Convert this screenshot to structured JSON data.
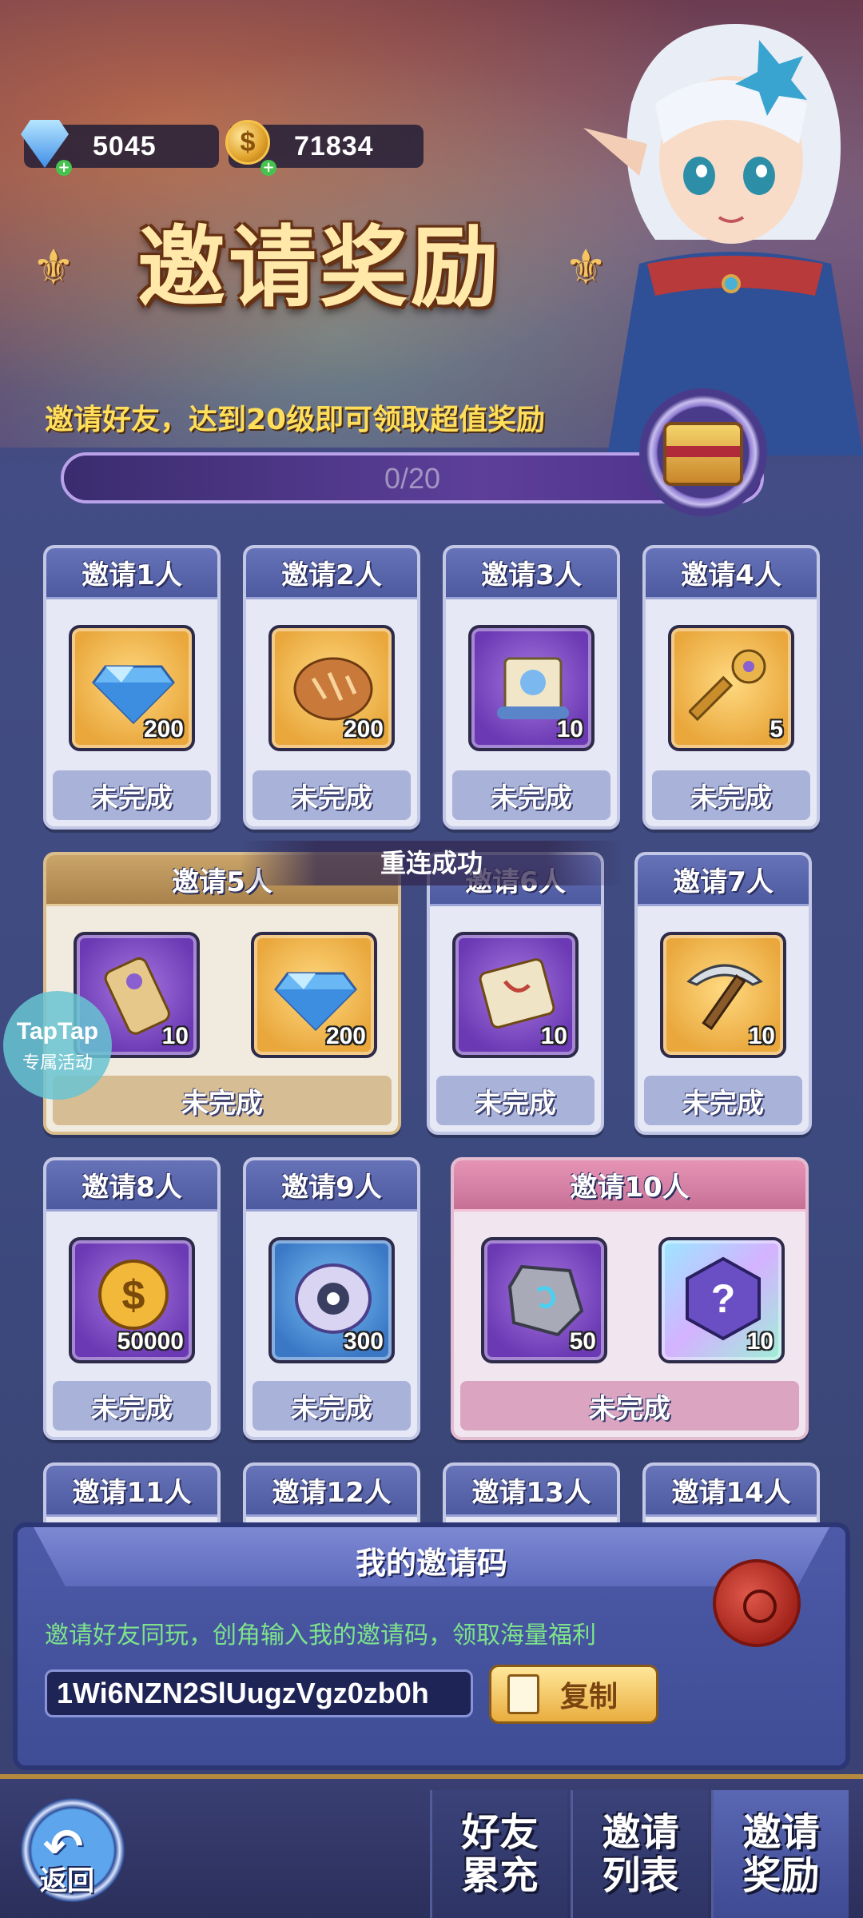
{
  "currency": {
    "gems": "5045",
    "coins": "71834"
  },
  "banner": {
    "title": "邀请奖励",
    "subtitle": "邀请好友，达到20级即可领取超值奖励",
    "progress_text": "0/20",
    "progress": 0
  },
  "toast": "重连成功",
  "taptap": {
    "brand": "TapTap",
    "label": "专属活动"
  },
  "cards": [
    {
      "title": "邀请1人",
      "status": "未完成",
      "items": [
        {
          "icon": "diamond-icon",
          "qty": "200"
        }
      ]
    },
    {
      "title": "邀请2人",
      "status": "未完成",
      "items": [
        {
          "icon": "bread-icon",
          "qty": "200"
        }
      ]
    },
    {
      "title": "邀请3人",
      "status": "未完成",
      "items": [
        {
          "icon": "scroll-icon",
          "qty": "10"
        }
      ]
    },
    {
      "title": "邀请4人",
      "status": "未完成",
      "items": [
        {
          "icon": "key-icon",
          "qty": "5"
        }
      ]
    },
    {
      "title": "邀请5人",
      "status": "未完成",
      "items": [
        {
          "icon": "scroll-roll-icon",
          "qty": "10"
        },
        {
          "icon": "diamond-icon",
          "qty": "200"
        }
      ]
    },
    {
      "title": "邀请6人",
      "status": "未完成",
      "items": [
        {
          "icon": "map-scroll-icon",
          "qty": "10"
        }
      ]
    },
    {
      "title": "邀请7人",
      "status": "未完成",
      "items": [
        {
          "icon": "pickaxe-icon",
          "qty": "10"
        }
      ]
    },
    {
      "title": "邀请8人",
      "status": "未完成",
      "items": [
        {
          "icon": "coin-icon",
          "qty": "50000"
        }
      ]
    },
    {
      "title": "邀请9人",
      "status": "未完成",
      "items": [
        {
          "icon": "sawblade-icon",
          "qty": "300"
        }
      ]
    },
    {
      "title": "邀请10人",
      "status": "未完成",
      "items": [
        {
          "icon": "rune-stone-icon",
          "qty": "50"
        },
        {
          "icon": "mystery-box-icon",
          "qty": "10"
        }
      ]
    },
    {
      "title": "邀请11人"
    },
    {
      "title": "邀请12人"
    },
    {
      "title": "邀请13人"
    },
    {
      "title": "邀请14人"
    }
  ],
  "invite_code": {
    "title": "我的邀请码",
    "description": "邀请好友同玩，创角输入我的邀请码，领取海量福利",
    "code": "1Wi6NZN2SlUugzVgz0zb0h",
    "copy_label": "复制"
  },
  "nav": {
    "back_label": "返回",
    "tabs": [
      {
        "label_line1": "好友",
        "label_line2": "累充",
        "active": false
      },
      {
        "label_line1": "邀请",
        "label_line2": "列表",
        "active": false
      },
      {
        "label_line1": "邀请",
        "label_line2": "奖励",
        "active": true
      }
    ]
  },
  "colors": {
    "title_gold": "#ffe8a8",
    "subtitle_yellow": "#ffdf5a",
    "code_desc_green": "#7de38a",
    "card_header_blue": "#5a66ad",
    "card_header_gold": "#b8925a",
    "card_header_pink": "#d782a8"
  }
}
